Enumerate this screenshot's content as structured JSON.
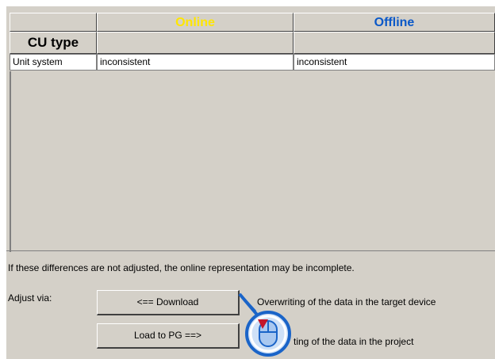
{
  "table": {
    "headers": [
      "",
      "Online",
      "Offline"
    ],
    "header_colors": {
      "online": "#ffe600",
      "offline": "#0a58c8"
    },
    "subheader": "CU type",
    "rows": [
      {
        "name": "Unit system",
        "online": "inconsistent",
        "offline": "inconsistent"
      }
    ]
  },
  "message": "If these differences are not adjusted, the online representation may be incomplete.",
  "adjust": {
    "label": "Adjust via:",
    "download_button": "<== Download",
    "download_desc": "Overwriting of the data in the target device",
    "load_button": "Load to PG ==>",
    "load_desc": "ting of the data in the project"
  },
  "cursor_icon": "mouse-click-icon"
}
